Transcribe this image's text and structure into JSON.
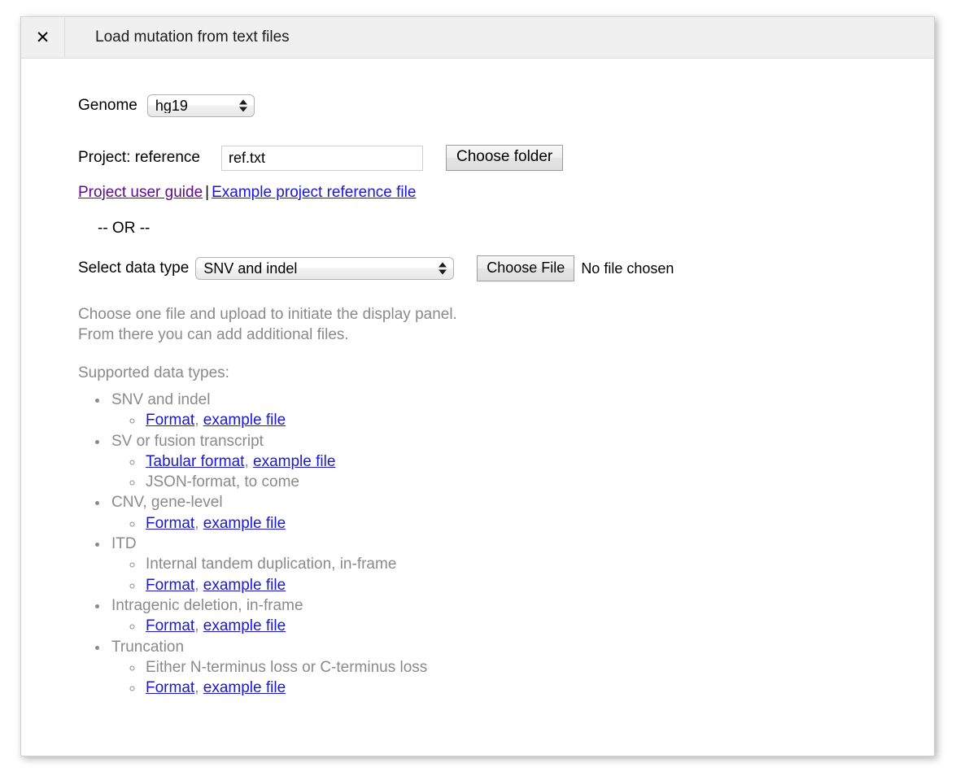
{
  "window": {
    "title": "Load mutation from text files",
    "close_icon": "close-icon"
  },
  "form": {
    "genome_label": "Genome",
    "genome_value": "hg19",
    "genome_options": [
      "hg19"
    ],
    "project_label": "Project: reference",
    "project_value": "ref.txt",
    "project_placeholder": "",
    "choose_folder_label": "Choose folder",
    "links": {
      "user_guide": "Project user guide",
      "separator": "|",
      "example_reference": "Example project reference file"
    },
    "or_text": "-- OR --",
    "datatype_label": "Select data type",
    "datatype_value": "SNV and indel",
    "datatype_options": [
      "SNV and indel"
    ],
    "choose_file_label": "Choose File",
    "no_file_text": "No file chosen"
  },
  "description": {
    "line1": "Choose one file and upload to initiate the display panel.",
    "line2": "From there you can add additional files.",
    "supported_heading": "Supported data types:"
  },
  "supported_types": [
    {
      "name": "SNV and indel",
      "sub": [
        {
          "format_link": "Format",
          "comma": ",",
          "example_link": "example file"
        }
      ]
    },
    {
      "name": "SV or fusion transcript",
      "sub": [
        {
          "format_link": "Tabular format",
          "comma": ",",
          "example_link": "example file"
        },
        {
          "plain": "JSON-format, to come"
        }
      ]
    },
    {
      "name": "CNV, gene-level",
      "sub": [
        {
          "format_link": "Format",
          "comma": ",",
          "example_link": "example file"
        }
      ]
    },
    {
      "name": "ITD",
      "sub": [
        {
          "plain": "Internal tandem duplication, in-frame"
        },
        {
          "format_link": "Format",
          "comma": ",",
          "example_link": "example file"
        }
      ]
    },
    {
      "name": "Intragenic deletion, in-frame",
      "sub": [
        {
          "format_link": "Format",
          "comma": ",",
          "example_link": "example file"
        }
      ]
    },
    {
      "name": "Truncation",
      "sub": [
        {
          "plain": "Either N-terminus loss or C-terminus loss"
        },
        {
          "format_link": "Format",
          "comma": ",",
          "example_link": "example file"
        }
      ]
    }
  ],
  "colors": {
    "link_blue": "#1a17d6",
    "link_visited": "#5f0a8a",
    "muted_text": "#8a8a8a",
    "header_bg": "#f0f0f0"
  }
}
